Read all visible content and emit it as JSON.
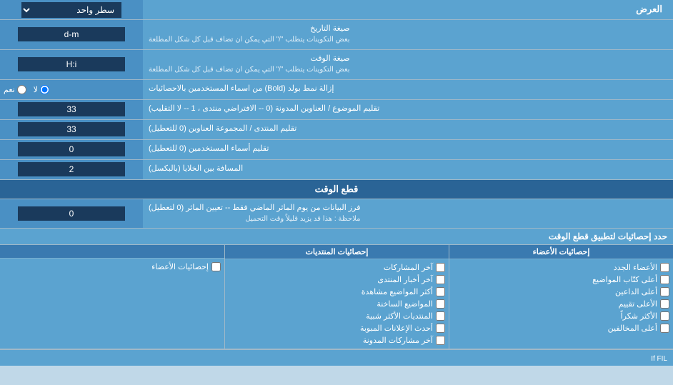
{
  "header": {
    "title": "العرض",
    "dropdown_label": "سطر واحد"
  },
  "rows": [
    {
      "id": "date_format",
      "label": "صيغة التاريخ\nبعض التكوينات يتطلب \"/\" التي يمكن ان تضاف قبل كل شكل المطلعة",
      "input_value": "d-m",
      "input_type": "text"
    },
    {
      "id": "time_format",
      "label": "صيغة الوقت\nبعض التكوينات يتطلب \"/\" التي يمكن ان تضاف قبل كل شكل المطلعة",
      "input_value": "H:i",
      "input_type": "text"
    },
    {
      "id": "bold_remove",
      "label": "إزالة نمط بولد (Bold) من اسماء المستخدمين بالاحصائيات",
      "input_type": "radio",
      "radio_yes": "نعم",
      "radio_no": "لا",
      "radio_selected": "no"
    },
    {
      "id": "subject_titles",
      "label": "تقليم الموضوع / العناوين المدونة (0 -- الافتراضي منتدى ، 1 -- لا التقليب)",
      "input_value": "33",
      "input_type": "text"
    },
    {
      "id": "forum_titles",
      "label": "تقليم المنتدى / المجموعة العناوين (0 للتعطيل)",
      "input_value": "33",
      "input_type": "text"
    },
    {
      "id": "user_names",
      "label": "تقليم أسماء المستخدمين (0 للتعطيل)",
      "input_value": "0",
      "input_type": "text"
    },
    {
      "id": "cell_spacing",
      "label": "المسافة بين الخلايا (بالبكسل)",
      "input_value": "2",
      "input_type": "text"
    }
  ],
  "time_cut_section": {
    "title": "قطع الوقت",
    "row": {
      "label": "فرز البيانات من يوم الماثر الماضي فقط -- تعيين الماثر (0 لتعطيل)\nملاحظة : هذا قد يزيد قليلاً وقت التحميل",
      "input_value": "0",
      "input_type": "text"
    }
  },
  "statistics_section": {
    "title": "حدد إحصائيات لتطبيق قطع الوقت",
    "col1_header": "إحصائيات الأعضاء",
    "col2_header": "إحصائيات المنتديات",
    "col3_header": "",
    "col1_items": [
      "الأعضاء الجدد",
      "أعلى كتّاب المواضيع",
      "أعلى الداعين",
      "الأعلى تقييم",
      "الأكثر شكراً",
      "أعلى المخالفين"
    ],
    "col2_items": [
      "آخر المشاركات",
      "آخر أخبار المنتدى",
      "أكثر المواضيع مشاهدة",
      "المواضيع الساخنة",
      "المنتديات الأكثر شبية",
      "أحدث الإعلانات المبوبة",
      "آخر مشاركات المدونة"
    ],
    "col3_items": [
      "إحصائيات الأعضاء"
    ]
  }
}
